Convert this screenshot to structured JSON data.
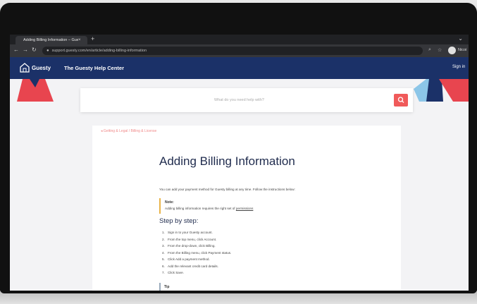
{
  "browser": {
    "tab_title": "Adding Billing Information – Gue",
    "tab_close": "×",
    "new_tab": "+",
    "minimize": "⌄",
    "url": "support.guesty.com/en/article/adding-billing-information",
    "profile_name": "Nicoi"
  },
  "site": {
    "brand": "Guesty",
    "help_center": "The Guesty Help Center",
    "sign_in": "Sign in"
  },
  "search": {
    "placeholder": "What do you need help with?"
  },
  "article": {
    "breadcrumb": "◂  Getting & Legal / Billing & License",
    "title": "Adding Billing Information",
    "intro": "You can add your payment method for Guesty billing at any time. Follow the instructions below:",
    "note_heading": "Note:",
    "note_text": "Adding billing information requires the right set of",
    "note_link": "permissions",
    "steps_heading": "Step by step:",
    "steps": [
      {
        "n": "1.",
        "text": "Sign in to your Guesty account."
      },
      {
        "n": "2.",
        "text": "From the top menu, click Account."
      },
      {
        "n": "3.",
        "text": "From the drop-down, click Billing."
      },
      {
        "n": "4.",
        "text": "From the Billing menu, click Payment status."
      },
      {
        "n": "5.",
        "text": "Click Add a payment method."
      },
      {
        "n": "6.",
        "text": "Add the relevant credit card details."
      },
      {
        "n": "7.",
        "text": "Click Save."
      }
    ],
    "tip_heading": "Tip"
  },
  "colors": {
    "header_bg": "#1b3168",
    "accent": "#f05a5a",
    "title": "#1f2b4d"
  }
}
